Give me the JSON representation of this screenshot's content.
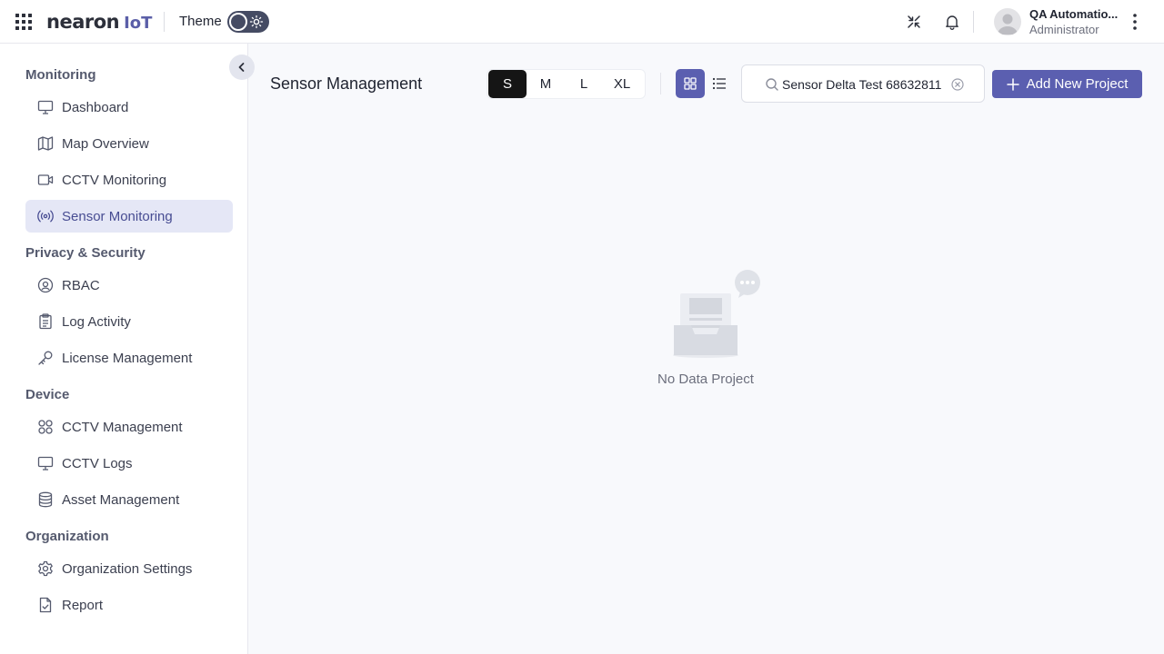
{
  "header": {
    "logo_text": "nearon",
    "logo_suffix": "IoT",
    "theme_label": "Theme",
    "user_name": "QA Automatio...",
    "user_role": "Administrator",
    "icons": [
      "apps-grid-icon",
      "sun-icon",
      "collapse-arrows-icon",
      "bell-icon",
      "avatar",
      "kebab-menu-icon"
    ]
  },
  "sidebar": {
    "sections": [
      {
        "title": "Monitoring",
        "items": [
          {
            "label": "Dashboard",
            "icon": "monitor-icon"
          },
          {
            "label": "Map Overview",
            "icon": "map-icon"
          },
          {
            "label": "CCTV Monitoring",
            "icon": "video-icon"
          },
          {
            "label": "Sensor Monitoring",
            "icon": "broadcast-icon",
            "active": true
          }
        ]
      },
      {
        "title": "Privacy & Security",
        "items": [
          {
            "label": "RBAC",
            "icon": "rbac-icon"
          },
          {
            "label": "Log Activity",
            "icon": "clipboard-icon"
          },
          {
            "label": "License Management",
            "icon": "key-icon"
          }
        ]
      },
      {
        "title": "Device",
        "items": [
          {
            "label": "CCTV Management",
            "icon": "grid-icon"
          },
          {
            "label": "CCTV Logs",
            "icon": "monitor-icon"
          },
          {
            "label": "Asset Management",
            "icon": "database-icon"
          }
        ]
      },
      {
        "title": "Organization",
        "items": [
          {
            "label": "Organization Settings",
            "icon": "gear-icon"
          },
          {
            "label": "Report",
            "icon": "file-check-icon"
          }
        ]
      }
    ]
  },
  "main": {
    "title": "Sensor Management",
    "sizes": [
      "S",
      "M",
      "L",
      "XL"
    ],
    "selected_size": "S",
    "view_mode": "grid",
    "search_value": "Sensor Delta Test 68632811",
    "add_button": "Add New Project",
    "empty_text": "No Data Project"
  },
  "colors": {
    "accent": "#5b5fb0",
    "active_nav_bg": "#e5e7f6",
    "main_bg": "#f8f9fc"
  }
}
